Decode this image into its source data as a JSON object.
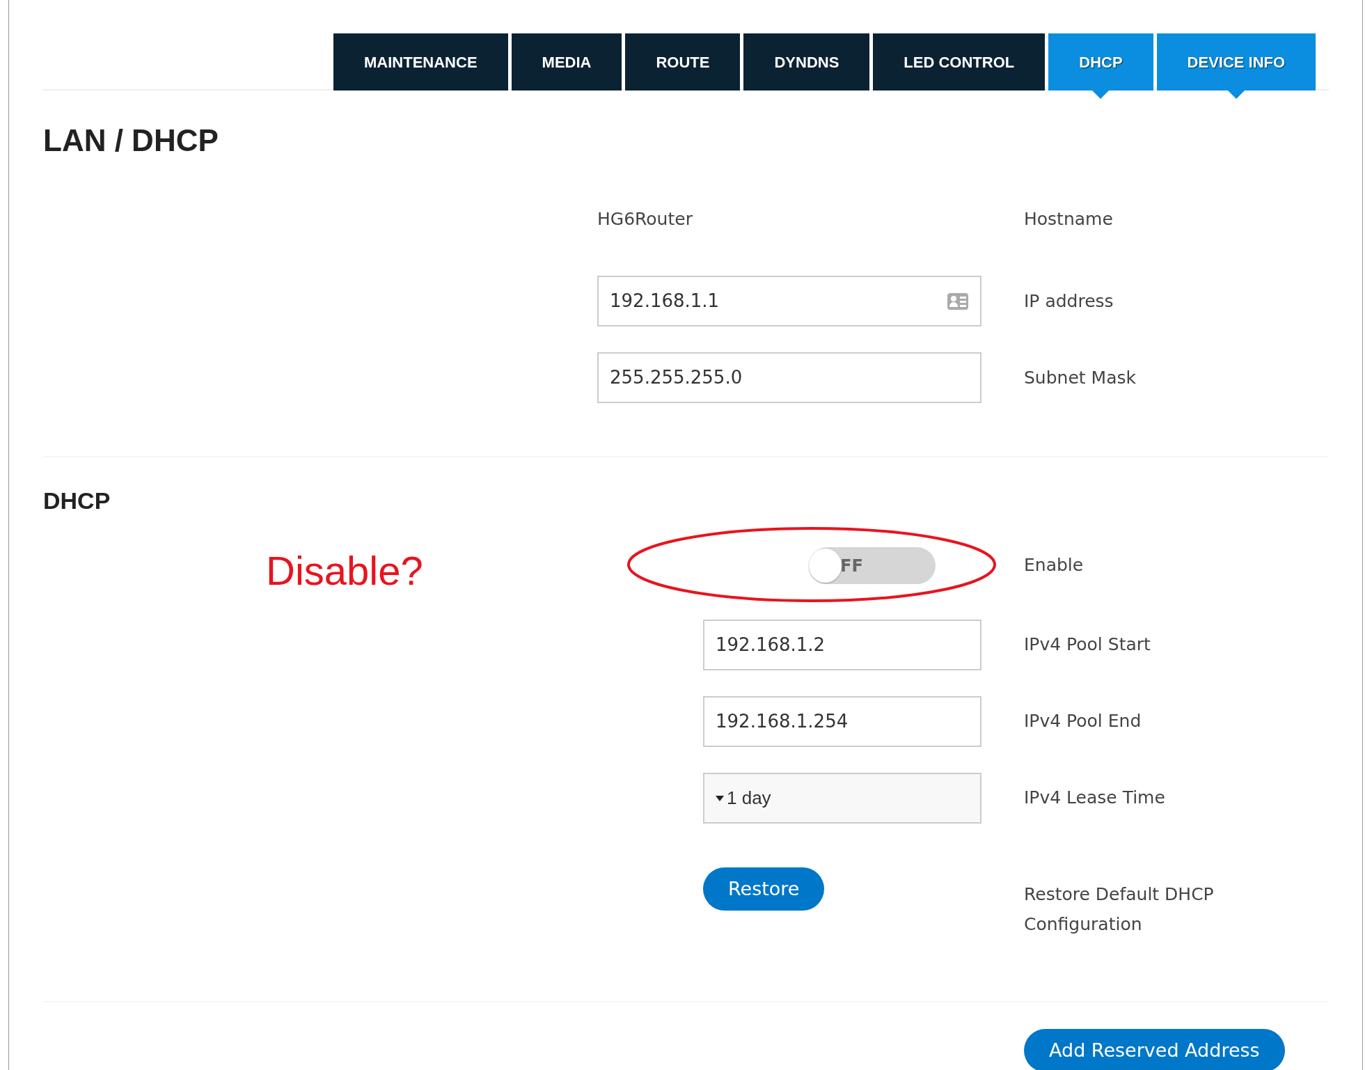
{
  "tabs": [
    {
      "label": "MAINTENANCE",
      "selected": false
    },
    {
      "label": "MEDIA",
      "selected": false
    },
    {
      "label": "ROUTE",
      "selected": false
    },
    {
      "label": "DYNDNS",
      "selected": false
    },
    {
      "label": "LED CONTROL",
      "selected": false
    },
    {
      "label": "DHCP",
      "selected": true
    },
    {
      "label": "DEVICE INFO",
      "selected": true
    }
  ],
  "title": "LAN / DHCP",
  "lan_fields": [
    {
      "kind": "text",
      "value": "HG6Router",
      "label": "Hostname"
    },
    {
      "kind": "input",
      "value": "192.168.1.1",
      "label": "IP address",
      "contact_icon": true
    },
    {
      "kind": "input",
      "value": "255.255.255.0",
      "label": "Subnet Mask"
    }
  ],
  "dhcp": {
    "heading": "DHCP",
    "annotation": "Disable?",
    "fields": [
      {
        "kind": "toggle",
        "on": false,
        "value": "FF",
        "label": "Enable",
        "highlighted": true
      },
      {
        "kind": "input",
        "value": "192.168.1.2",
        "label": "IPv4 Pool Start"
      },
      {
        "kind": "input",
        "value": "192.168.1.254",
        "label": "IPv4 Pool End"
      },
      {
        "kind": "select",
        "value": "1 day",
        "label": "IPv4 Lease Time"
      },
      {
        "kind": "button",
        "value": "Restore",
        "label": "Restore Default DHCP Configuration"
      }
    ]
  },
  "add_button": "Add Reserved Address"
}
